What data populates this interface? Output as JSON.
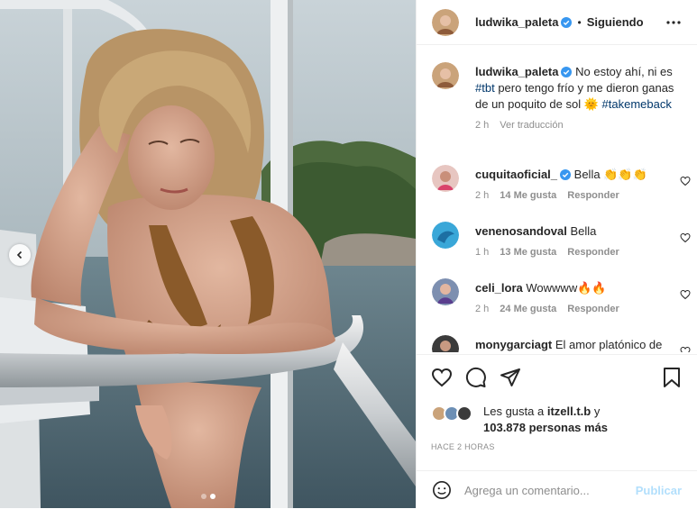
{
  "post": {
    "author": "ludwika_paleta",
    "separator": "•",
    "follow_state": "Siguiendo"
  },
  "caption": {
    "username": "ludwika_paleta",
    "text_before": "No estoy ahí, ni es",
    "tag1": "#tbt",
    "text_after": "pero tengo frío y me dieron ganas de un poquito de sol",
    "emoji": "🌞",
    "tag2": "#takemeback",
    "time": "2 h",
    "translate": "Ver traducción"
  },
  "comments": [
    {
      "username": "cuquitaoficial_",
      "verified": true,
      "text": "Bella 👏👏👏",
      "time": "2 h",
      "likes": "14 Me gusta",
      "reply": "Responder"
    },
    {
      "username": "venenosandoval",
      "verified": false,
      "text": "Bella",
      "time": "1 h",
      "likes": "13 Me gusta",
      "reply": "Responder"
    },
    {
      "username": "celi_lora",
      "verified": false,
      "text": "Wowwww🔥🔥",
      "time": "2 h",
      "likes": "24 Me gusta",
      "reply": "Responder"
    },
    {
      "username": "monygarciagt",
      "verified": false,
      "text": "El amor platónico de",
      "time": "",
      "likes": "",
      "reply": ""
    }
  ],
  "likes": {
    "line1": "Les gusta a ",
    "user": "itzell.t.b",
    "line1_end": " y",
    "line2": "103.878 personas más"
  },
  "timestamp": "HACE 2 HORAS",
  "composer": {
    "placeholder": "Agrega un comentario...",
    "publish": "Publicar"
  },
  "icons": {
    "more": "more-dots-icon",
    "like": "heart-icon",
    "comment": "comment-bubble-icon",
    "share": "paper-plane-icon",
    "save": "bookmark-icon",
    "emoji": "smiley-icon",
    "prev": "chevron-left-icon"
  },
  "colors": {
    "verified": "#3897f0",
    "link": "#00376b",
    "muted": "#8e8e8e",
    "publish_disabled": "#b2dffc"
  },
  "carousel": {
    "total": 2,
    "active": 2
  }
}
